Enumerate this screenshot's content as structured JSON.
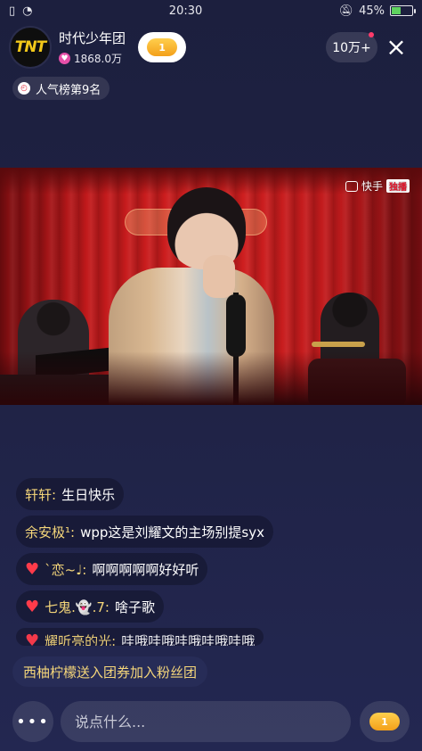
{
  "status_bar": {
    "time": "20:30",
    "battery": "45%",
    "battery_level": 0.45
  },
  "anchor": {
    "avatar_text": "TNT",
    "name": "时代少年团",
    "likes": "1868.0万",
    "rank_badge": "1"
  },
  "header": {
    "viewer_count": "10万+",
    "close_icon": "×"
  },
  "rank_tag": "人气榜第9名",
  "video": {
    "watermark": "快手",
    "watermark_tag": "独播"
  },
  "chat": [
    {
      "user": "轩轩:",
      "text": "生日快乐",
      "heart": false
    },
    {
      "user": "余安极¹:",
      "text": "wpp这是刘耀文的主场别提syx",
      "heart": false
    },
    {
      "user": "`恋~♩:",
      "text": "啊啊啊啊啊好好听",
      "heart": true
    },
    {
      "user": "七鬼.👻.7:",
      "text": "啥子歌",
      "heart": true
    },
    {
      "user": "耀听亮的光:",
      "text": "哇哦哇哦哇哦哇哦哇哦",
      "heart": true
    }
  ],
  "join_notice": "西柚柠檬送入团券加入粉丝团",
  "bottom": {
    "more_icon": "•••",
    "input_placeholder": "说点什么...",
    "gift_badge": "1"
  }
}
